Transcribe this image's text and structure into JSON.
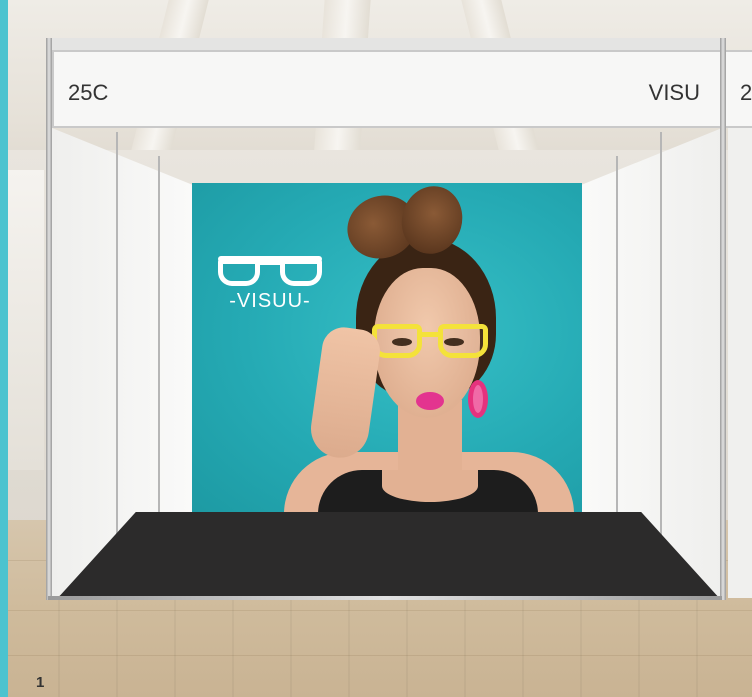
{
  "booth": {
    "number": "25C",
    "company": "VISU",
    "neighbor_number_partial": "2"
  },
  "banner": {
    "logo_text": "-VISUU-",
    "colors": {
      "background": "#25aab4",
      "glasses_frame": "#f4e23a",
      "lips": "#e3348f",
      "earring": "#e6327e"
    }
  },
  "page": {
    "number": "1"
  },
  "accent": "#4cc3cf"
}
